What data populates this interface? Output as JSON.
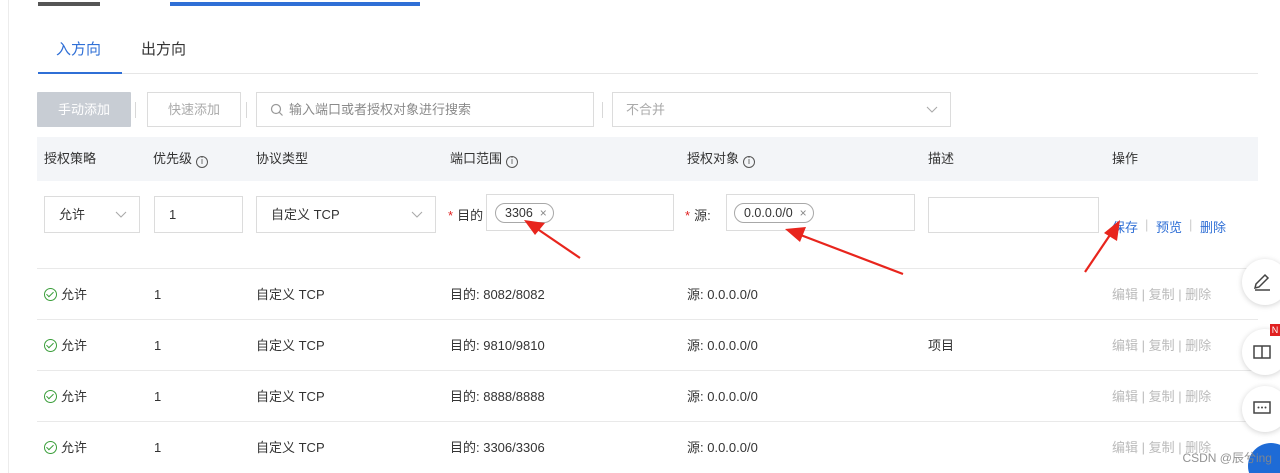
{
  "tabs": [
    {
      "label": "入方向",
      "active": true
    },
    {
      "label": "出方向",
      "active": false
    }
  ],
  "toolbar": {
    "manual_add": "手动添加",
    "quick_add": "快速添加",
    "search_placeholder": "输入端口或者授权对象进行搜索",
    "merge_value": "不合并"
  },
  "table": {
    "headers": {
      "policy": "授权策略",
      "priority": "优先级",
      "protocol": "协议类型",
      "port_range": "端口范围",
      "auth_object": "授权对象",
      "description": "描述",
      "actions": "操作"
    },
    "edit_row": {
      "policy": "允许",
      "priority": "1",
      "protocol": "自定义 TCP",
      "port_label": "目的",
      "port_tag": "3306",
      "source_label": "源:",
      "source_tag": "0.0.0.0/0",
      "description": "",
      "save": "保存",
      "preview": "预览",
      "delete": "删除"
    },
    "rows": [
      {
        "policy": "允许",
        "priority": "1",
        "protocol": "自定义 TCP",
        "port": "目的: 8082/8082",
        "source": "源: 0.0.0.0/0",
        "description": ""
      },
      {
        "policy": "允许",
        "priority": "1",
        "protocol": "自定义 TCP",
        "port": "目的: 9810/9810",
        "source": "源: 0.0.0.0/0",
        "description": "项目"
      },
      {
        "policy": "允许",
        "priority": "1",
        "protocol": "自定义 TCP",
        "port": "目的: 8888/8888",
        "source": "源: 0.0.0.0/0",
        "description": ""
      },
      {
        "policy": "允许",
        "priority": "1",
        "protocol": "自定义 TCP",
        "port": "目的: 3306/3306",
        "source": "源: 0.0.0.0/0",
        "description": ""
      }
    ],
    "row_actions": {
      "edit": "编辑",
      "copy": "复制",
      "delete": "删除"
    }
  },
  "watermark": "CSDN @辰兮ing",
  "colors": {
    "accent": "#2f6fd6",
    "arrow": "#e8251d",
    "success": "#3a9e3a"
  }
}
